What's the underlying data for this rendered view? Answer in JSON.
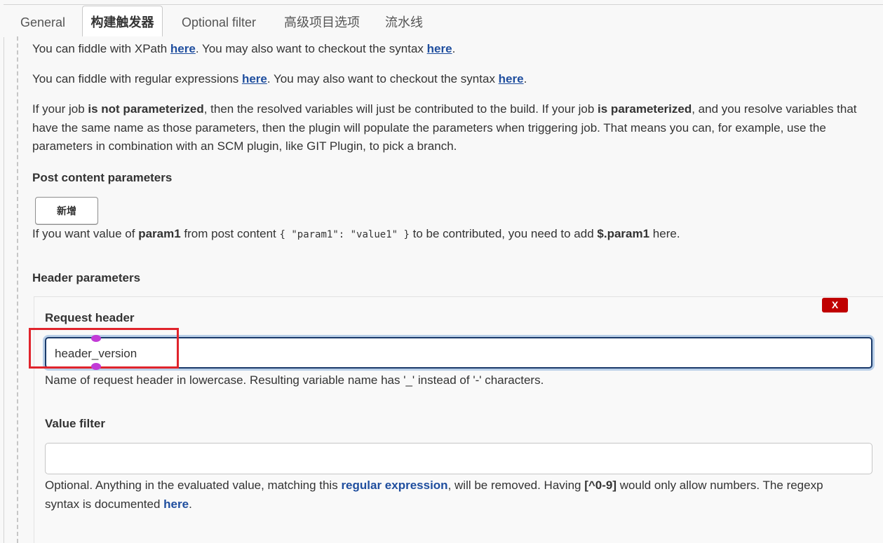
{
  "tabs": [
    {
      "label": "General"
    },
    {
      "label": "构建触发器",
      "active": true
    },
    {
      "label": "Optional filter"
    },
    {
      "label": "高级项目选项"
    },
    {
      "label": "流水线"
    }
  ],
  "intro": {
    "xpath_prefix": "You can fiddle with XPath ",
    "xpath_link": "here",
    "xpath_mid": ". You may also want to checkout the syntax ",
    "xpath_link2": "here",
    "xpath_end": ".",
    "regex_prefix": "You can fiddle with regular expressions ",
    "regex_link": "here",
    "regex_mid": ". You may also want to checkout the syntax ",
    "regex_link2": "here",
    "regex_end": ".",
    "param_l1_a": "If your job ",
    "param_l1_b": "is not parameterized",
    "param_l1_c": ", then the resolved variables will just be contributed to the build. If your job ",
    "param_l1_d": "is parameterized",
    "param_l1_e": ", and you resolve variables that",
    "param_l2": "have the same name as those parameters, then the plugin will populate the parameters when triggering job. That means you can, for example, use the",
    "param_l3": "parameters in combination with an SCM plugin, like GIT Plugin, to pick a branch."
  },
  "post_content": {
    "heading": "Post content parameters",
    "add_label": "新增",
    "help_a": "If you want value of ",
    "help_b": "param1",
    "help_c": " from post content ",
    "help_code": "{ \"param1\": \"value1\" }",
    "help_d": " to be contributed, you need to add ",
    "help_e": "$.param1",
    "help_f": " here."
  },
  "header_params": {
    "heading": "Header parameters",
    "delete_label": "X",
    "request_header_label": "Request header",
    "request_header_value": "header_version",
    "request_header_help": "Name of request header in lowercase. Resulting variable name has '_' instead of '-' characters.",
    "value_filter_label": "Value filter",
    "value_filter_value": "",
    "vf_help_a": "Optional. Anything in the evaluated value, matching this ",
    "vf_help_link": "regular expression",
    "vf_help_b": ", will be removed. Having ",
    "vf_help_code": "[^0-9]",
    "vf_help_c": " would only allow numbers. The regexp",
    "vf_help_d": "syntax is documented ",
    "vf_help_link2": "here",
    "vf_help_e": "."
  },
  "colors": {
    "link": "#1f4e9e",
    "delete": "#c00000",
    "highlight": "#e0242c",
    "focus_border": "#1b3a6a"
  }
}
